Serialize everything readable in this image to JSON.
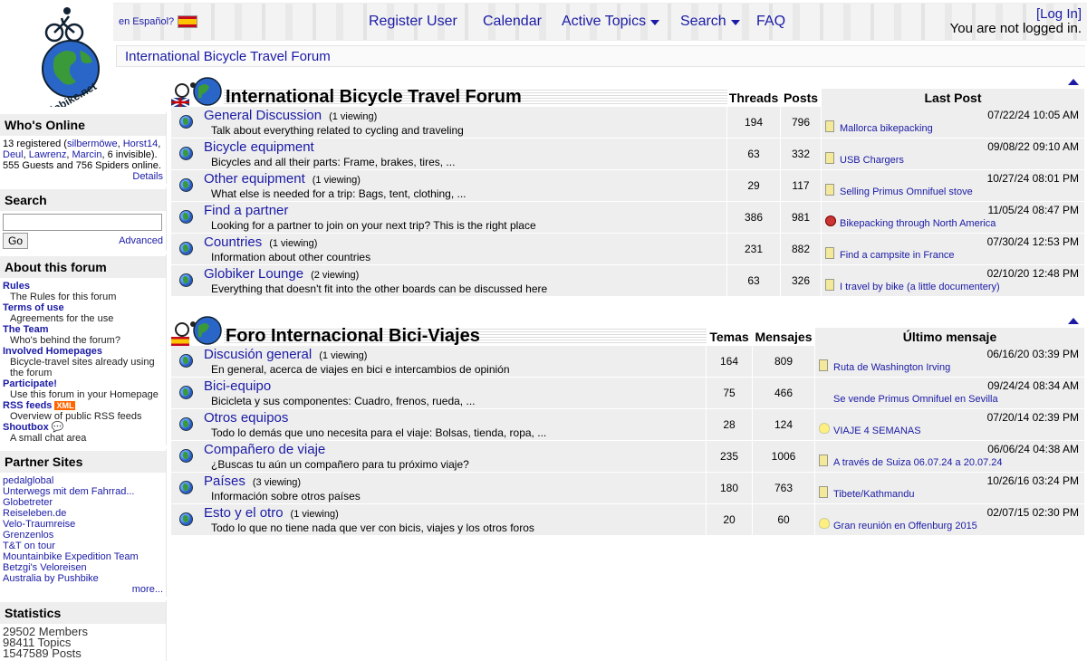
{
  "header": {
    "logo_text": "globike.net",
    "lang_link": "en Español?",
    "nav": {
      "register": "Register User",
      "calendar": "Calendar",
      "active_topics": "Active Topics",
      "search": "Search",
      "faq": "FAQ"
    },
    "login_link": "[Log In]",
    "login_status": "You are not logged in.",
    "breadcrumb": "International Bicycle Travel Forum"
  },
  "sidebar": {
    "whos_online": {
      "title": "Who's Online",
      "line_prefix": "13 registered (",
      "users": [
        "silbermöwe",
        "Horst14",
        "Deul",
        "Lawrenz",
        "Marcin"
      ],
      "line_suffix": ", 6 invisible).",
      "guests": "555 Guests and 756 Spiders online.",
      "details": "Details"
    },
    "search": {
      "title": "Search",
      "go": "Go",
      "advanced": "Advanced",
      "value": ""
    },
    "about": {
      "title": "About this forum",
      "items": [
        {
          "label": "Rules",
          "desc": "The Rules for this forum"
        },
        {
          "label": "Terms of use",
          "desc": "Agreements for the use"
        },
        {
          "label": "The Team",
          "desc": "Who's behind the forum?"
        },
        {
          "label": "Involved Homepages",
          "desc": "Bicycle-travel sites already using the forum"
        },
        {
          "label": "Participate!",
          "desc": "Use this forum in your Homepage"
        },
        {
          "label": "RSS feeds",
          "badge": "XML",
          "desc": "Overview of public RSS feeds"
        },
        {
          "label": "Shoutbox",
          "desc": "A small chat area"
        }
      ]
    },
    "partners": {
      "title": "Partner Sites",
      "items": [
        "pedalglobal",
        "Unterwegs mit dem Fahrrad...",
        "Globetreter",
        "Reiseleben.de",
        "Velo-Traumreise",
        "Grenzenlos",
        "T&T on tour",
        "Mountainbike Expedition Team",
        "Betzgi's Veloreisen",
        "Australia by Pushbike"
      ],
      "more": "more..."
    },
    "stats": {
      "title": "Statistics",
      "members": "29502 Members",
      "topics": "98411 Topics",
      "posts": "1547589 Posts"
    }
  },
  "forums_en": {
    "title": "International Bicycle Travel Forum",
    "col_threads": "Threads",
    "col_posts": "Posts",
    "col_last": "Last Post",
    "rows": [
      {
        "name": "General Discussion",
        "viewing": "(1 viewing)",
        "desc": "Talk about everything related to cycling and traveling",
        "threads": "194",
        "posts": "796",
        "date": "07/22/24 10:05 AM",
        "topic": "Mallorca bikepacking",
        "icon": "note"
      },
      {
        "name": "Bicycle equipment",
        "viewing": "",
        "desc": "Bicycles and all their parts: Frame, brakes, tires, ...",
        "threads": "63",
        "posts": "332",
        "date": "09/08/22 09:10 AM",
        "topic": "USB Chargers",
        "icon": "note"
      },
      {
        "name": "Other equipment",
        "viewing": "(1 viewing)",
        "desc": "What else is needed for a trip: Bags, tent, clothing, ...",
        "threads": "29",
        "posts": "117",
        "date": "10/27/24 08:01 PM",
        "topic": "Selling Primus Omnifuel stove",
        "icon": "note"
      },
      {
        "name": "Find a partner",
        "viewing": "",
        "desc": "Looking for a partner to join on your next trip? This is the right place",
        "threads": "386",
        "posts": "981",
        "date": "11/05/24 08:47 PM",
        "topic": "Bikepacking through North America",
        "icon": "hot"
      },
      {
        "name": "Countries",
        "viewing": "(1 viewing)",
        "desc": "Information about other countries",
        "threads": "231",
        "posts": "882",
        "date": "07/30/24 12:53 PM",
        "topic": "Find a campsite in France",
        "icon": "note"
      },
      {
        "name": "Globiker Lounge",
        "viewing": "(2 viewing)",
        "desc": "Everything that doesn't fit into the other boards can be discussed here",
        "threads": "63",
        "posts": "326",
        "date": "02/10/20 12:48 PM",
        "topic": "I travel by bike (a little documentery)",
        "icon": "note"
      }
    ]
  },
  "forums_es": {
    "title": "Foro Internacional Bici-Viajes",
    "col_threads": "Temas",
    "col_posts": "Mensajes",
    "col_last": "Último mensaje",
    "rows": [
      {
        "name": "Discusión general",
        "viewing": "(1 viewing)",
        "desc": "En general, acerca de viajes en bici e intercambios de opinión",
        "threads": "164",
        "posts": "809",
        "date": "06/16/20 03:39 PM",
        "topic": "Ruta de Washington Irving",
        "icon": "note"
      },
      {
        "name": "Bici-equipo",
        "viewing": "",
        "desc": "Bicicleta y sus componentes: Cuadro, frenos, rueda, ...",
        "threads": "75",
        "posts": "466",
        "date": "09/24/24 08:34 AM",
        "topic": "Se vende Primus Omnifuel en Sevilla",
        "icon": "none"
      },
      {
        "name": "Otros equipos",
        "viewing": "",
        "desc": "Todo lo demás que uno necesita para el viaje: Bolsas, tienda, ropa, ...",
        "threads": "28",
        "posts": "124",
        "date": "07/20/14 02:39 PM",
        "topic": "VIAJE 4 SEMANAS",
        "icon": "bulb"
      },
      {
        "name": "Compañero de viaje",
        "viewing": "",
        "desc": "¿Buscas tu aún un compañero para tu próximo viaje?",
        "threads": "235",
        "posts": "1006",
        "date": "06/06/24 04:38 AM",
        "topic": "A través de Suiza 06.07.24 a 20.07.24",
        "icon": "note"
      },
      {
        "name": "Países",
        "viewing": "(3 viewing)",
        "desc": "Información sobre otros países",
        "threads": "180",
        "posts": "763",
        "date": "10/26/16 03:24 PM",
        "topic": "Tibete/Kathmandu",
        "icon": "note"
      },
      {
        "name": "Esto y el otro",
        "viewing": "(1 viewing)",
        "desc": "Todo lo que no tiene nada que ver con bicis, viajes y los otros foros",
        "threads": "20",
        "posts": "60",
        "date": "02/07/15 02:30 PM",
        "topic": "Gran reunión en Offenburg 2015",
        "icon": "bulb"
      }
    ]
  }
}
